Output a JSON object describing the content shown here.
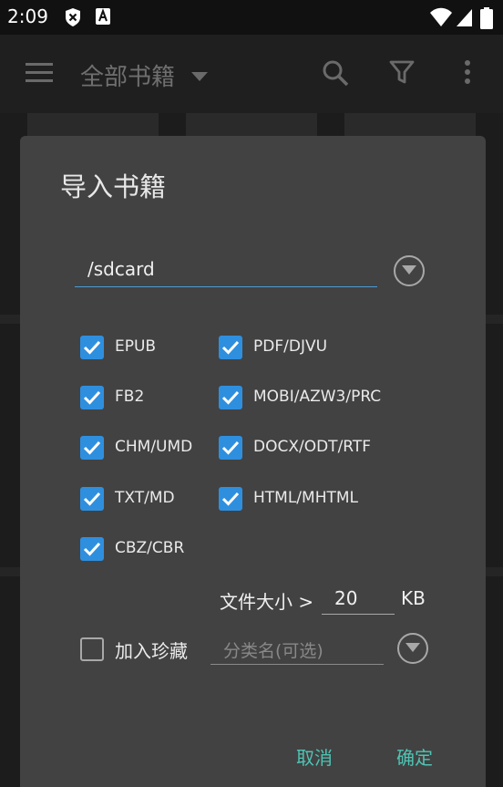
{
  "status_bar": {
    "time": "2:09"
  },
  "app_bar": {
    "title": "全部书籍"
  },
  "dialog": {
    "title": "导入书籍",
    "path_value": "/sdcard",
    "formats": [
      {
        "label": "EPUB",
        "checked": true
      },
      {
        "label": "PDF/DJVU",
        "checked": true
      },
      {
        "label": "FB2",
        "checked": true
      },
      {
        "label": "MOBI/AZW3/PRC",
        "checked": true
      },
      {
        "label": "CHM/UMD",
        "checked": true
      },
      {
        "label": "DOCX/ODT/RTF",
        "checked": true
      },
      {
        "label": "TXT/MD",
        "checked": true
      },
      {
        "label": "HTML/MHTML",
        "checked": true
      },
      {
        "label": "CBZ/CBR",
        "checked": true
      }
    ],
    "file_size_label": "文件大小 >",
    "file_size_value": "20",
    "file_size_unit": "KB",
    "add_to_favorites_label": "加入珍藏",
    "add_to_favorites_checked": false,
    "category_placeholder": "分类名(可选)",
    "cancel_label": "取消",
    "ok_label": "确定"
  },
  "colors": {
    "accent": "#2f8fdf",
    "button_text": "#4fc4b4",
    "dialog_bg": "#424242"
  }
}
